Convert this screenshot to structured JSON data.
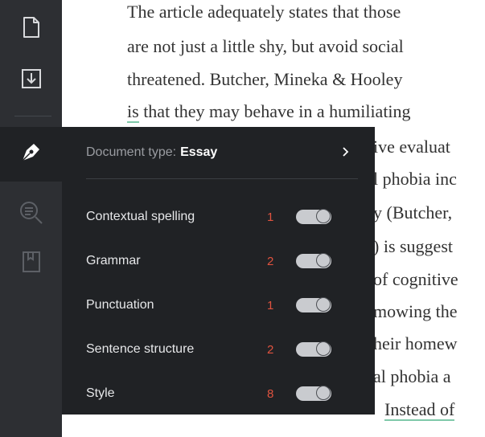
{
  "document": {
    "lines": [
      "The article adequately states that those",
      "are not just a little shy, but avoid social",
      "threatened. Butcher, Mineka & Hooley",
      "is that they may behave in a humiliating",
      "ive evaluat",
      "l phobia inc",
      "y (Butcher,",
      ") is suggest",
      "of cognitive",
      "mowing the",
      "heir homew",
      "al phobia a",
      "Instead of"
    ]
  },
  "sidebar": {
    "icons": [
      "document-icon",
      "download-icon",
      "pen-nib-icon",
      "search-doc-icon",
      "book-icon"
    ]
  },
  "panel": {
    "doc_type_label": "Document type:",
    "doc_type_value": "Essay",
    "rows": [
      {
        "label": "Contextual spelling",
        "count": "1",
        "enabled": true
      },
      {
        "label": "Grammar",
        "count": "2",
        "enabled": true
      },
      {
        "label": "Punctuation",
        "count": "1",
        "enabled": true
      },
      {
        "label": "Sentence structure",
        "count": "2",
        "enabled": true
      },
      {
        "label": "Style",
        "count": "8",
        "enabled": true
      }
    ]
  },
  "colors": {
    "sidebar_bg": "#2d2f33",
    "panel_bg": "#202225",
    "count_red": "#e0533f",
    "underline_green": "#7fc8a9"
  }
}
